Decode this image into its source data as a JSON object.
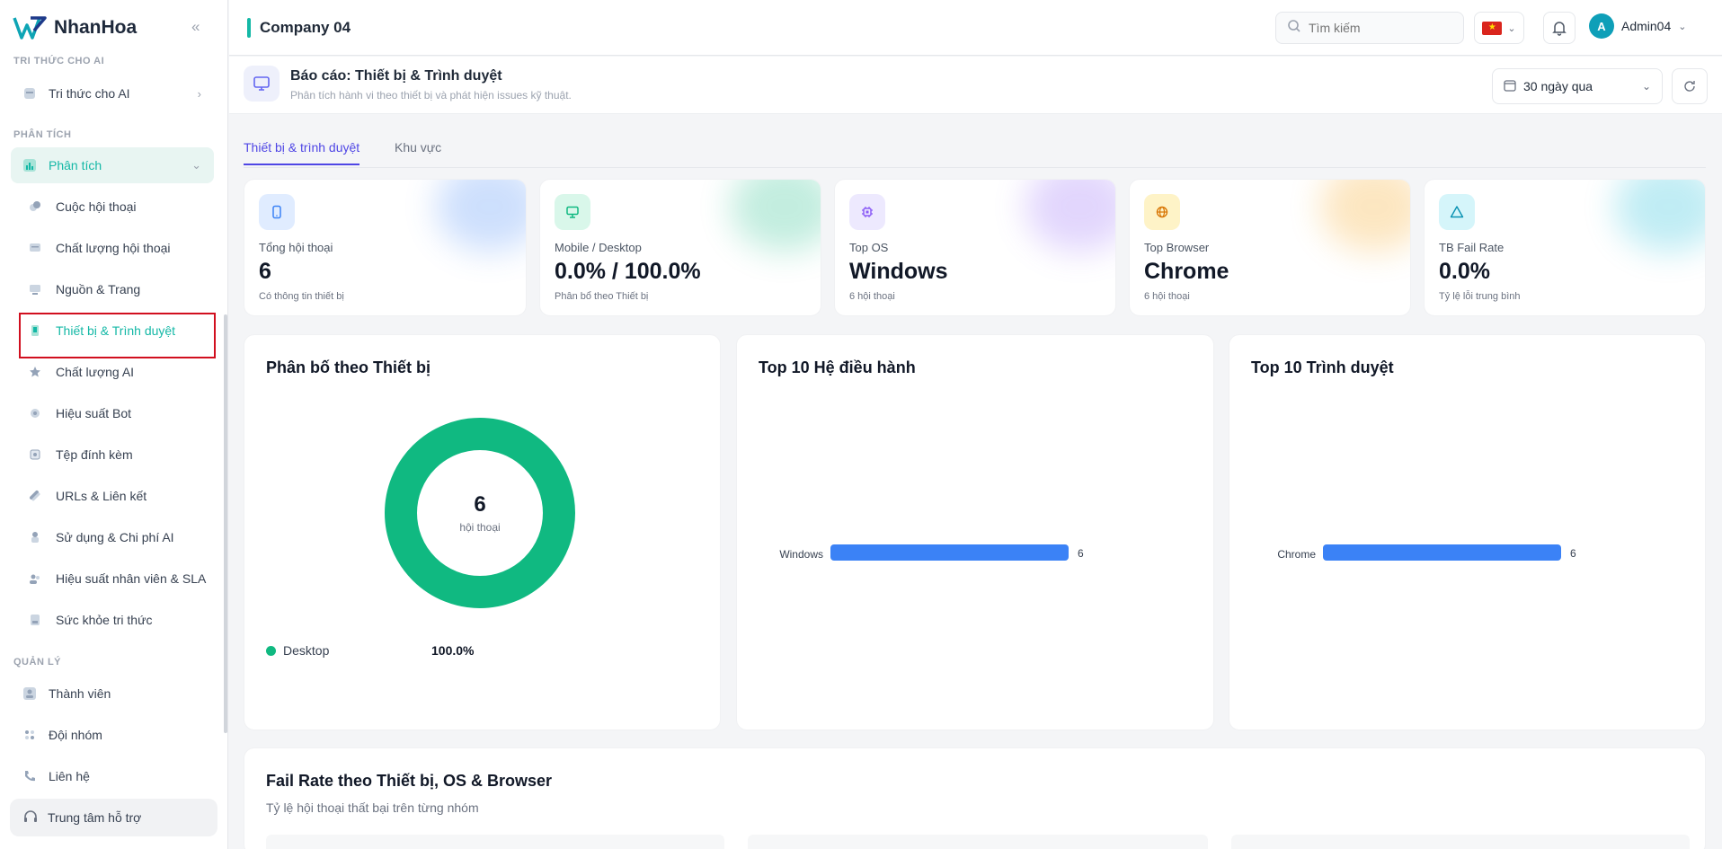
{
  "brand": {
    "name": "NhanHoa"
  },
  "sidebar": {
    "sections": {
      "knowledge": "TRI THỨC CHO AI",
      "analytics": "PHÂN TÍCH",
      "manage": "QUẢN LÝ"
    },
    "knowledge_item": "Tri thức cho AI",
    "analytics_item": "Phân tích",
    "analytics_sub": [
      "Cuộc hội thoại",
      "Chất lượng hội thoại",
      "Nguồn & Trang",
      "Thiết bị & Trình duyệt",
      "Chất lượng AI",
      "Hiệu suất Bot",
      "Tệp đính kèm",
      "URLs & Liên kết",
      "Sử dụng & Chi phí AI",
      "Hiệu suất nhân viên & SLA",
      "Sức khỏe tri thức"
    ],
    "manage_items": [
      "Thành viên",
      "Đội nhóm",
      "Liên hệ"
    ],
    "support": "Trung tâm hỗ trợ"
  },
  "topbar": {
    "company": "Company 04",
    "search_placeholder": "Tìm kiếm",
    "user": "Admin04",
    "avatar_letter": "A"
  },
  "report": {
    "title": "Báo cáo: Thiết bị & Trình duyệt",
    "subtitle": "Phân tích hành vi theo thiết bị và phát hiện issues kỹ thuật.",
    "range": "30 ngày qua"
  },
  "tabs": [
    "Thiết bị & trình duyệt",
    "Khu vực"
  ],
  "kpis": [
    {
      "label": "Tổng hội thoại",
      "value": "6",
      "sub": "Có thông tin thiết bị",
      "color": "#3b82f6",
      "bg": "#e0ecff",
      "icon": "phone-icon"
    },
    {
      "label": "Mobile / Desktop",
      "value": "0.0% / 100.0%",
      "sub": "Phân bổ theo Thiết bị",
      "color": "#10b981",
      "bg": "#d9f7ea",
      "icon": "monitor-icon"
    },
    {
      "label": "Top OS",
      "value": "Windows",
      "sub": "6 hội thoại",
      "color": "#8b5cf6",
      "bg": "#ede9fe",
      "icon": "chip-icon"
    },
    {
      "label": "Top Browser",
      "value": "Chrome",
      "sub": "6 hội thoại",
      "color": "#f59e0b",
      "bg": "#fef3c7",
      "icon": "globe-icon"
    },
    {
      "label": "TB Fail Rate",
      "value": "0.0%",
      "sub": "Tỷ lệ lỗi trung bình",
      "color": "#06b6d4",
      "bg": "#d5f5fa",
      "icon": "warning-icon"
    }
  ],
  "device_chart": {
    "title": "Phân bố theo Thiết bị",
    "center_value": "6",
    "center_label": "hội thoại",
    "legend": [
      {
        "label": "Desktop",
        "value": "100.0%"
      }
    ],
    "color": "#10b981"
  },
  "chart_data": [
    {
      "type": "pie",
      "title": "Phân bố theo Thiết bị",
      "categories": [
        "Desktop"
      ],
      "values": [
        6
      ],
      "percent": [
        100.0
      ]
    },
    {
      "type": "bar",
      "orientation": "horizontal",
      "title": "Top 10 Hệ điều hành",
      "categories": [
        "Windows"
      ],
      "values": [
        6
      ],
      "color": "#3b82f6"
    },
    {
      "type": "bar",
      "orientation": "horizontal",
      "title": "Top 10 Trình duyệt",
      "categories": [
        "Chrome"
      ],
      "values": [
        6
      ],
      "color": "#3b82f6"
    }
  ],
  "bottom": {
    "title": "Fail Rate theo Thiết bị, OS & Browser",
    "subtitle": "Tỷ lệ hội thoại thất bại trên từng nhóm"
  }
}
